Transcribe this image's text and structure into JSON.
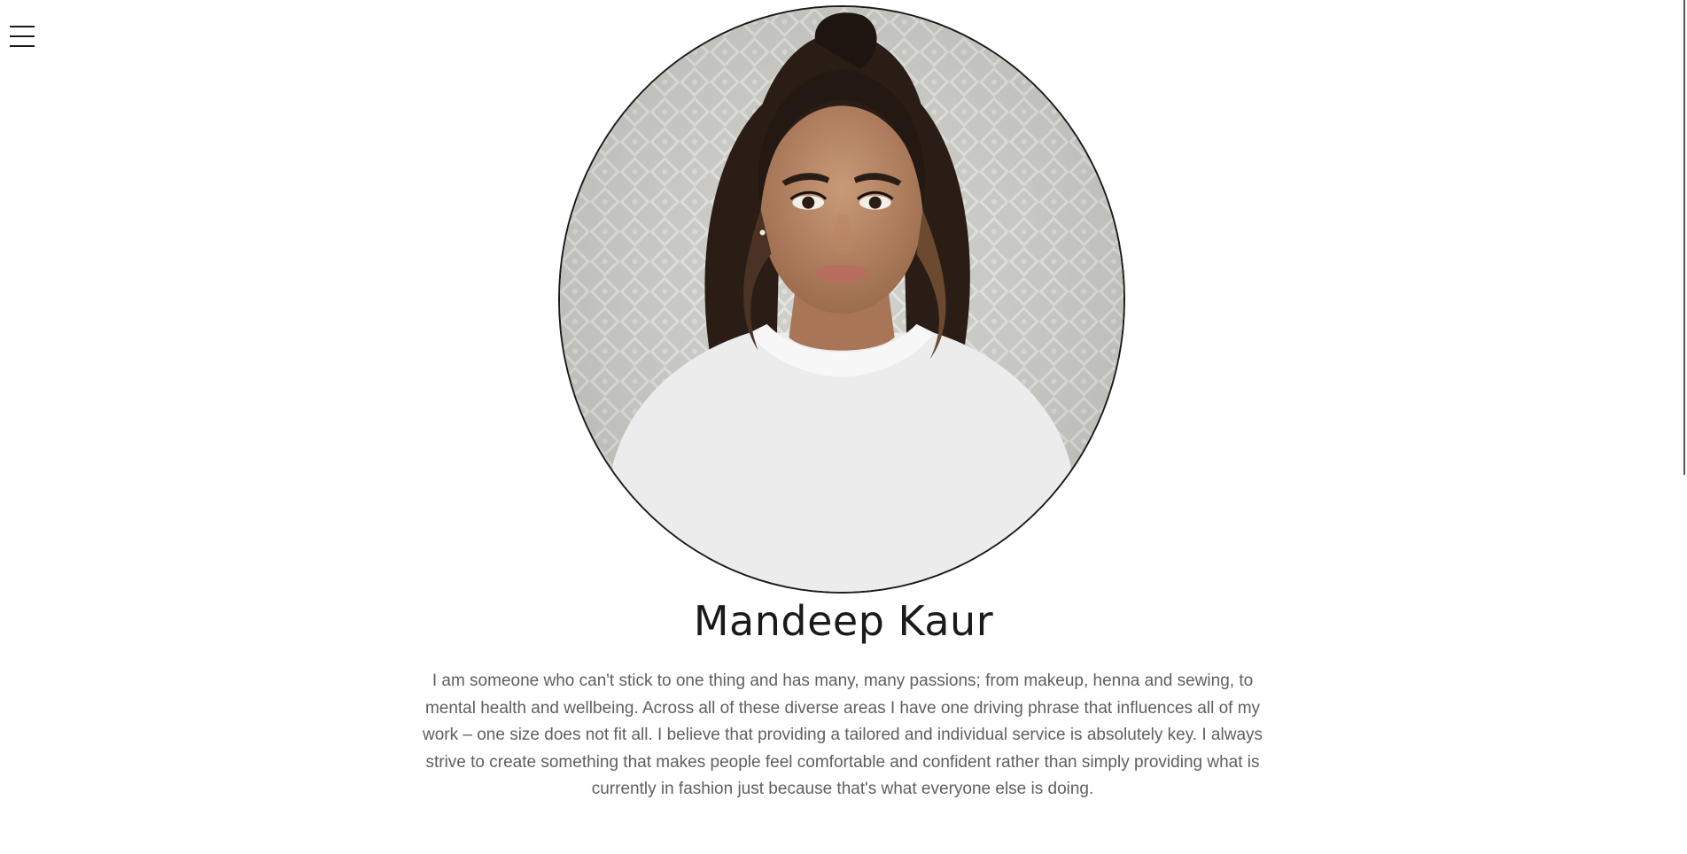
{
  "menu": {
    "icon": "hamburger-menu-icon"
  },
  "profile": {
    "name": "Mandeep Kaur",
    "bio": "I am someone who can't stick to one thing and has many, many passions; from makeup, henna and sewing, to mental health and wellbeing. Across all of these diverse areas I have one driving phrase that influences all of my work – one size does not fit all. I believe that providing a tailored and individual service is absolutely key. I always strive to create something that makes people feel comfortable and confident rather than simply providing what is currently in fashion just because that's what everyone else is doing.",
    "portrait_icon": "portrait-photo"
  },
  "colors": {
    "text_dark": "#1a1a1a",
    "text_body": "#5f5f5f",
    "background": "#ffffff"
  }
}
